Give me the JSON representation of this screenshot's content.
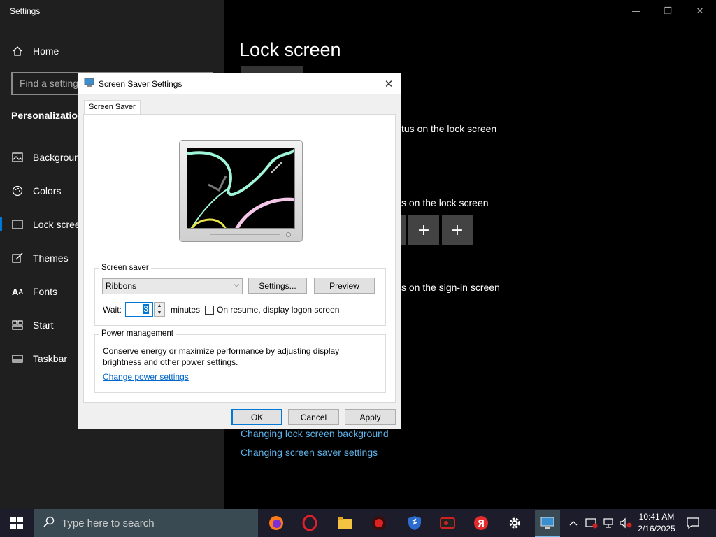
{
  "settings": {
    "window_title": "Settings",
    "search_placeholder": "Find a setting",
    "home_label": "Home",
    "section_label": "Personalization",
    "nav_items": [
      {
        "label": "Background",
        "icon": "image-icon"
      },
      {
        "label": "Colors",
        "icon": "palette-icon"
      },
      {
        "label": "Lock screen",
        "icon": "lock-screen-icon",
        "active": true
      },
      {
        "label": "Themes",
        "icon": "brush-icon"
      },
      {
        "label": "Fonts",
        "icon": "font-icon"
      },
      {
        "label": "Start",
        "icon": "start-grid-icon"
      },
      {
        "label": "Taskbar",
        "icon": "taskbar-icon"
      }
    ],
    "page_title": "Lock screen",
    "text_detailed_status": "tus on the lock screen",
    "text_quick_status": "s on the lock screen",
    "text_signin": "s on the sign-in screen",
    "links": [
      "Changing lock screen background",
      "Changing screen saver settings"
    ]
  },
  "dialog": {
    "title": "Screen Saver Settings",
    "tab_label": "Screen Saver",
    "screen_saver_group": "Screen saver",
    "selected_saver": "Ribbons",
    "settings_button": "Settings...",
    "preview_button": "Preview",
    "wait_label": "Wait:",
    "wait_value": "3",
    "minutes_label": "minutes",
    "resume_checkbox_label": "On resume, display logon screen",
    "resume_checked": false,
    "power_group": "Power management",
    "power_text": "Conserve energy or maximize performance by adjusting display brightness and other power settings.",
    "power_link": "Change power settings",
    "ok_button": "OK",
    "cancel_button": "Cancel",
    "apply_button": "Apply"
  },
  "taskbar": {
    "search_placeholder": "Type here to search",
    "time": "10:41 AM",
    "date": "2/16/2025",
    "accent_color": "#0078d7"
  }
}
